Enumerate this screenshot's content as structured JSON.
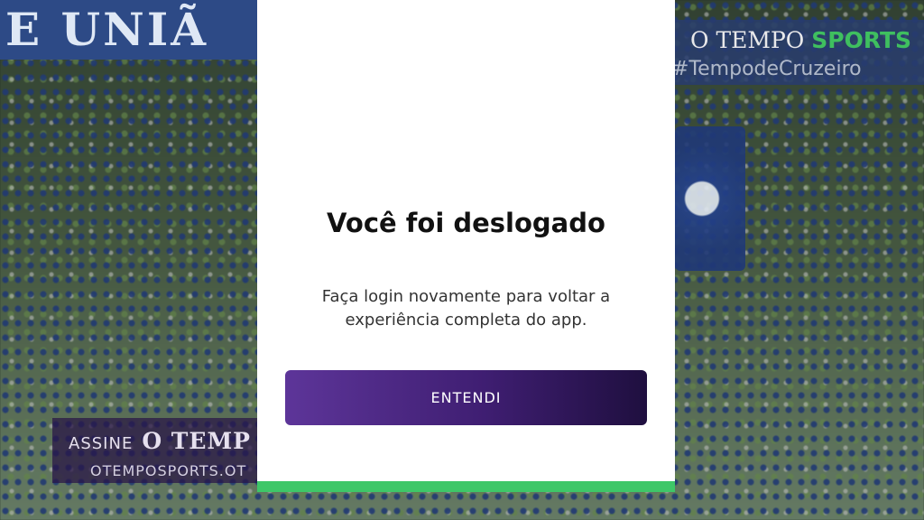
{
  "background": {
    "banner_top_text": "E UNIÃ",
    "watermark_brand": "O TEMPO",
    "watermark_sports": "SPORTS",
    "watermark_hashtag": "#TempodeCruzeiro",
    "ad_subscribe": "ASSINE",
    "ad_brand": "O TEMP",
    "ad_url": "OTEMPOSPORTS.OT"
  },
  "modal": {
    "title": "Você foi deslogado",
    "message": "Faça login novamente para voltar a experiência completa do app.",
    "button_label": "ENTENDI",
    "accent_color": "#3ec768",
    "button_color": "#4a2680"
  }
}
